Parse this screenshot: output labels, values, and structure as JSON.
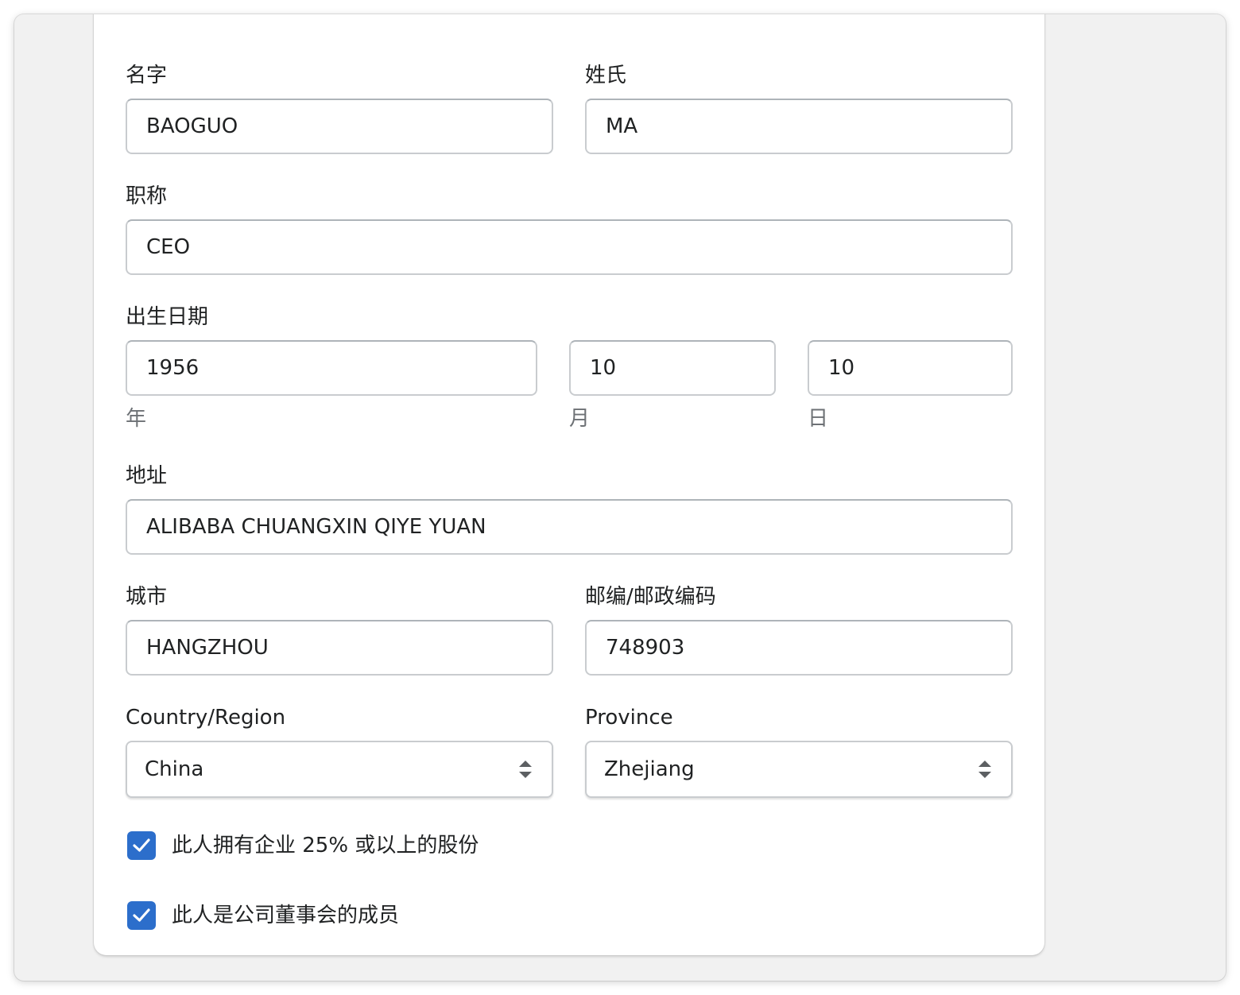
{
  "form": {
    "first_name": {
      "label": "名字",
      "value": "BAOGUO"
    },
    "last_name": {
      "label": "姓氏",
      "value": "MA"
    },
    "job_title": {
      "label": "职称",
      "value": "CEO"
    },
    "birth_date": {
      "label": "出生日期",
      "year": {
        "value": "1956",
        "label": "年"
      },
      "month": {
        "value": "10",
        "label": "月"
      },
      "day": {
        "value": "10",
        "label": "日"
      }
    },
    "address": {
      "label": "地址",
      "value": "ALIBABA CHUANGXIN QIYE YUAN"
    },
    "city": {
      "label": "城市",
      "value": "HANGZHOU"
    },
    "postal_code": {
      "label": "邮编/邮政编码",
      "value": "748903"
    },
    "country": {
      "label": "Country/Region",
      "value": "China"
    },
    "province": {
      "label": "Province",
      "value": "Zhejiang"
    },
    "checkboxes": [
      {
        "label": "此人拥有企业 25% 或以上的股份",
        "checked": true
      },
      {
        "label": "此人是公司董事会的成员",
        "checked": true
      }
    ]
  },
  "colors": {
    "accent": "#2c6ecb",
    "border": "#c9cccf",
    "text": "#202223",
    "muted": "#6d7175",
    "background": "#f1f1f1"
  }
}
